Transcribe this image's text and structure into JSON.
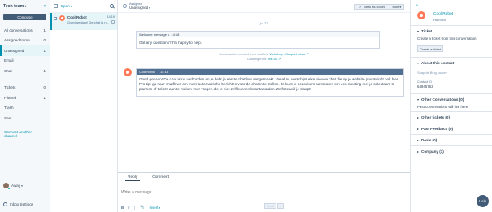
{
  "sidebar": {
    "team_title": "Tech team",
    "compose_label": "Compose",
    "items": [
      {
        "label": "All conversations",
        "count": "1"
      },
      {
        "label": "Assigned to me",
        "count": "0"
      },
      {
        "label": "Unassigned",
        "count": "1"
      },
      {
        "label": "Email",
        "count": ""
      },
      {
        "label": "Chat",
        "count": "1"
      }
    ],
    "items2": [
      {
        "label": "Tickets",
        "count": "0"
      },
      {
        "label": "Filtered",
        "count": "1"
      },
      {
        "label": "Trash",
        "count": ""
      },
      {
        "label": "Sent",
        "count": ""
      }
    ],
    "connect_link": "Connect another channel",
    "user_status": "Away",
    "settings_label": "Inbox Settings"
  },
  "conversation_list": {
    "filter_label": "Open",
    "item": {
      "name": "Cool Robot",
      "preview": "Goed gedaan! De chat is nu verbonden",
      "time": "14:19"
    }
  },
  "thread_header": {
    "assignee_label": "Assignee",
    "assignee_value": "Unassigned",
    "mark_closed_label": "Mark as closed",
    "more_label": "More"
  },
  "thread": {
    "date": "jul 27",
    "welcome_header": "Welcome message",
    "welcome_time": "14:18",
    "welcome_text": "Got any questions? I'm happy to help.",
    "created_line1_prefix": "Conversation created from chatflow",
    "created_line1_link": "Webshop - Support Inbox",
    "created_line2_prefix": "Chatting from:",
    "created_line2_link": "test.url",
    "bot_name": "Cool Robot",
    "bot_time": "14:18",
    "bot_text": "Goed gedaan! De chat is nu verbonden en je hebt je eerste chatflow aangemaakt. Vanaf nu verschijnt elke nieuwe chat die op je website plaatsvindt ook hier. Pro-tip: ga naar chatflows om meer automatische berichten voor de chat in te stellen. Je kunt je bezoekers aansporen om een meeting met je salesteam te plannen of tickets aan te maken voor vragen die je niet zelf kunnen beantwoorden. Zelfs terwijl je slaapt!"
  },
  "composer": {
    "tab_reply": "Reply",
    "tab_comment": "Comment",
    "placeholder": "Write a message",
    "insert_label": "Insert",
    "send_label": "Send"
  },
  "right_panel": {
    "contact_name": "Cool Robot",
    "contact_company": "HubSpot",
    "ticket_header": "Ticket",
    "ticket_text": "Create a ticket from this conversation.",
    "create_ticket_label": "Create a ticket",
    "about_header": "About this contact",
    "about_muted": "Snapple Bing survey",
    "contact_id_label": "Contact ID",
    "contact_id_value": "64945763",
    "other_conv_header": "Other Conversations (0)",
    "other_conv_text": "Past conversations will live here.",
    "other_tickets_header": "Other tickets (0)",
    "past_feedback_header": "Past Feedback (0)",
    "deals_header": "Deals (0)",
    "company_header": "Company (1)"
  },
  "help_label": "Help",
  "colors": {
    "accent": "#0091ae",
    "brand_orange": "#ff7a59",
    "dark_slate": "#425b76"
  }
}
